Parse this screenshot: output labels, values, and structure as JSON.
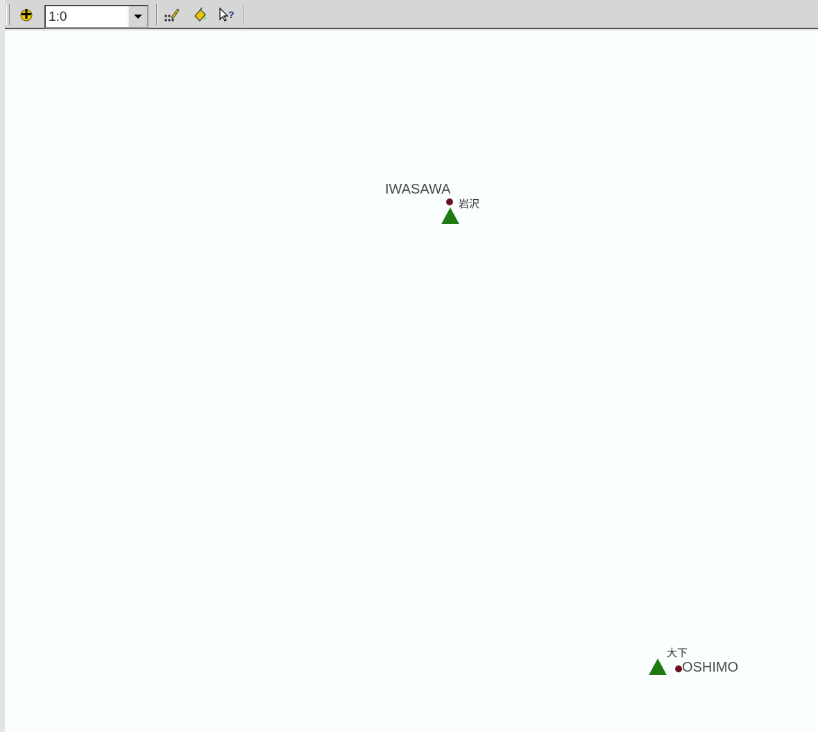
{
  "toolbar": {
    "scale_value": "1:0",
    "buttons": [
      {
        "name": "add-data-icon",
        "color": "#e8c800"
      },
      {
        "name": "editor-tool-icon"
      },
      {
        "name": "paint-bucket-icon"
      },
      {
        "name": "whats-this-help-icon"
      }
    ]
  },
  "map": {
    "sites": [
      {
        "label_en": "IWASAWA",
        "label_jp": "岩沢",
        "triangle_color": "#1f7a12",
        "dot_color": "#6a1020"
      },
      {
        "label_en": "OSHIMO",
        "label_jp": "大下",
        "triangle_color": "#1f7a12",
        "dot_color": "#6a1020"
      }
    ]
  }
}
